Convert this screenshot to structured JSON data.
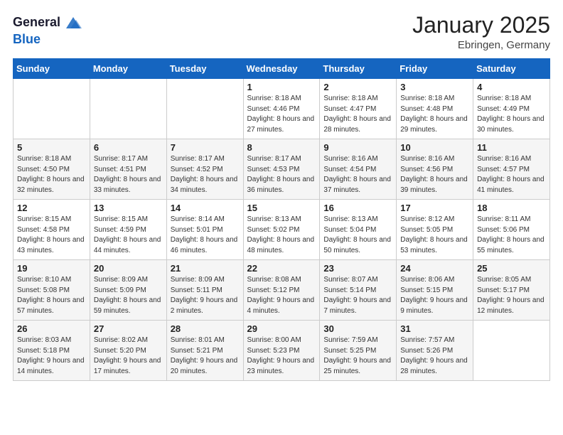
{
  "header": {
    "logo_line1": "General",
    "logo_line2": "Blue",
    "month": "January 2025",
    "location": "Ebringen, Germany"
  },
  "weekdays": [
    "Sunday",
    "Monday",
    "Tuesday",
    "Wednesday",
    "Thursday",
    "Friday",
    "Saturday"
  ],
  "weeks": [
    [
      {
        "day": "",
        "info": ""
      },
      {
        "day": "",
        "info": ""
      },
      {
        "day": "",
        "info": ""
      },
      {
        "day": "1",
        "info": "Sunrise: 8:18 AM\nSunset: 4:46 PM\nDaylight: 8 hours and 27 minutes."
      },
      {
        "day": "2",
        "info": "Sunrise: 8:18 AM\nSunset: 4:47 PM\nDaylight: 8 hours and 28 minutes."
      },
      {
        "day": "3",
        "info": "Sunrise: 8:18 AM\nSunset: 4:48 PM\nDaylight: 8 hours and 29 minutes."
      },
      {
        "day": "4",
        "info": "Sunrise: 8:18 AM\nSunset: 4:49 PM\nDaylight: 8 hours and 30 minutes."
      }
    ],
    [
      {
        "day": "5",
        "info": "Sunrise: 8:18 AM\nSunset: 4:50 PM\nDaylight: 8 hours and 32 minutes."
      },
      {
        "day": "6",
        "info": "Sunrise: 8:17 AM\nSunset: 4:51 PM\nDaylight: 8 hours and 33 minutes."
      },
      {
        "day": "7",
        "info": "Sunrise: 8:17 AM\nSunset: 4:52 PM\nDaylight: 8 hours and 34 minutes."
      },
      {
        "day": "8",
        "info": "Sunrise: 8:17 AM\nSunset: 4:53 PM\nDaylight: 8 hours and 36 minutes."
      },
      {
        "day": "9",
        "info": "Sunrise: 8:16 AM\nSunset: 4:54 PM\nDaylight: 8 hours and 37 minutes."
      },
      {
        "day": "10",
        "info": "Sunrise: 8:16 AM\nSunset: 4:56 PM\nDaylight: 8 hours and 39 minutes."
      },
      {
        "day": "11",
        "info": "Sunrise: 8:16 AM\nSunset: 4:57 PM\nDaylight: 8 hours and 41 minutes."
      }
    ],
    [
      {
        "day": "12",
        "info": "Sunrise: 8:15 AM\nSunset: 4:58 PM\nDaylight: 8 hours and 43 minutes."
      },
      {
        "day": "13",
        "info": "Sunrise: 8:15 AM\nSunset: 4:59 PM\nDaylight: 8 hours and 44 minutes."
      },
      {
        "day": "14",
        "info": "Sunrise: 8:14 AM\nSunset: 5:01 PM\nDaylight: 8 hours and 46 minutes."
      },
      {
        "day": "15",
        "info": "Sunrise: 8:13 AM\nSunset: 5:02 PM\nDaylight: 8 hours and 48 minutes."
      },
      {
        "day": "16",
        "info": "Sunrise: 8:13 AM\nSunset: 5:04 PM\nDaylight: 8 hours and 50 minutes."
      },
      {
        "day": "17",
        "info": "Sunrise: 8:12 AM\nSunset: 5:05 PM\nDaylight: 8 hours and 53 minutes."
      },
      {
        "day": "18",
        "info": "Sunrise: 8:11 AM\nSunset: 5:06 PM\nDaylight: 8 hours and 55 minutes."
      }
    ],
    [
      {
        "day": "19",
        "info": "Sunrise: 8:10 AM\nSunset: 5:08 PM\nDaylight: 8 hours and 57 minutes."
      },
      {
        "day": "20",
        "info": "Sunrise: 8:09 AM\nSunset: 5:09 PM\nDaylight: 8 hours and 59 minutes."
      },
      {
        "day": "21",
        "info": "Sunrise: 8:09 AM\nSunset: 5:11 PM\nDaylight: 9 hours and 2 minutes."
      },
      {
        "day": "22",
        "info": "Sunrise: 8:08 AM\nSunset: 5:12 PM\nDaylight: 9 hours and 4 minutes."
      },
      {
        "day": "23",
        "info": "Sunrise: 8:07 AM\nSunset: 5:14 PM\nDaylight: 9 hours and 7 minutes."
      },
      {
        "day": "24",
        "info": "Sunrise: 8:06 AM\nSunset: 5:15 PM\nDaylight: 9 hours and 9 minutes."
      },
      {
        "day": "25",
        "info": "Sunrise: 8:05 AM\nSunset: 5:17 PM\nDaylight: 9 hours and 12 minutes."
      }
    ],
    [
      {
        "day": "26",
        "info": "Sunrise: 8:03 AM\nSunset: 5:18 PM\nDaylight: 9 hours and 14 minutes."
      },
      {
        "day": "27",
        "info": "Sunrise: 8:02 AM\nSunset: 5:20 PM\nDaylight: 9 hours and 17 minutes."
      },
      {
        "day": "28",
        "info": "Sunrise: 8:01 AM\nSunset: 5:21 PM\nDaylight: 9 hours and 20 minutes."
      },
      {
        "day": "29",
        "info": "Sunrise: 8:00 AM\nSunset: 5:23 PM\nDaylight: 9 hours and 23 minutes."
      },
      {
        "day": "30",
        "info": "Sunrise: 7:59 AM\nSunset: 5:25 PM\nDaylight: 9 hours and 25 minutes."
      },
      {
        "day": "31",
        "info": "Sunrise: 7:57 AM\nSunset: 5:26 PM\nDaylight: 9 hours and 28 minutes."
      },
      {
        "day": "",
        "info": ""
      }
    ]
  ]
}
